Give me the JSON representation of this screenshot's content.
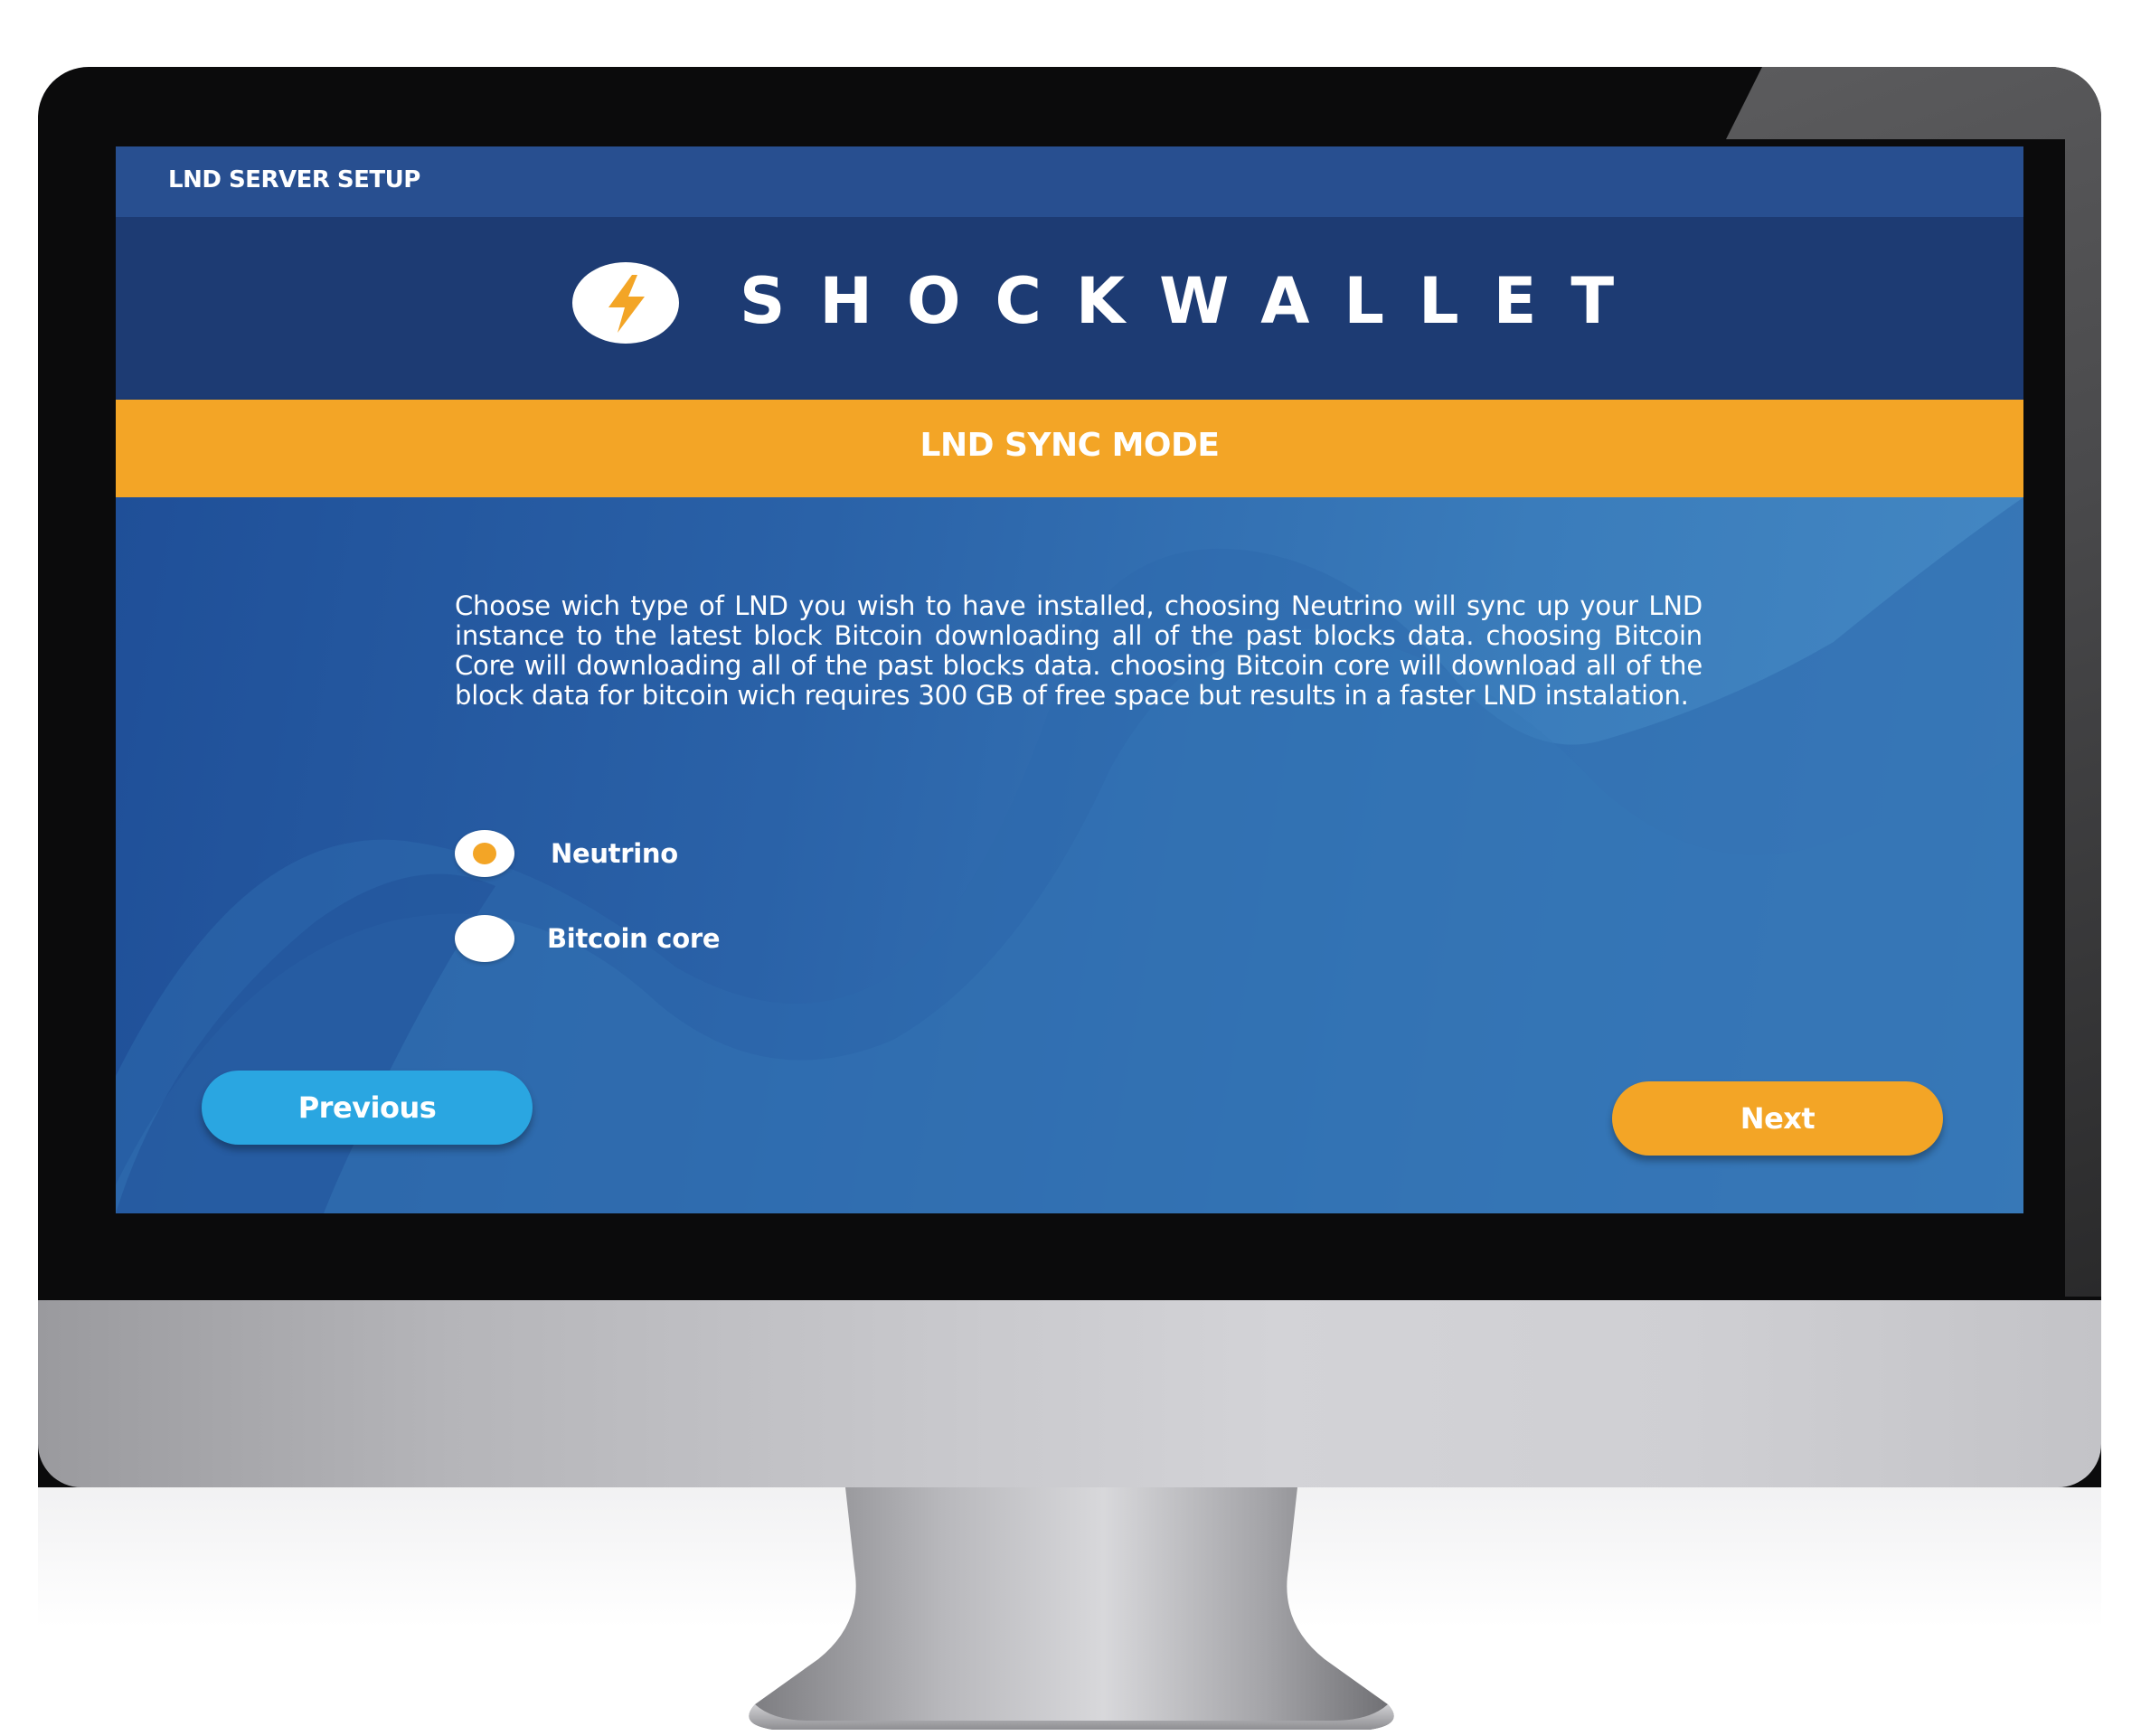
{
  "window": {
    "title": "LND SERVER SETUP"
  },
  "brand": {
    "name": "SHOCKWALLET",
    "logo_icon": "lightning-bolt-icon",
    "logo_color": "#f3a526"
  },
  "step": {
    "title": "LND SYNC MODE"
  },
  "description": "Choose wich type of LND you wish to have installed, choosing Neutrino will sync up your LND instance to the latest block Bitcoin downloading all of the past blocks data. choosing Bitcoin Core will downloading all of the past blocks data. choosing Bitcoin core will download all of the block data for bitcoin wich requires 300 GB of free space but results in a faster LND instalation.",
  "options": [
    {
      "label": "Neutrino",
      "selected": true
    },
    {
      "label": "Bitcoin core",
      "selected": false
    }
  ],
  "buttons": {
    "previous": "Previous",
    "next": "Next"
  },
  "colors": {
    "accent": "#f3a526",
    "secondary": "#2aa6e1",
    "header": "#1d3b73"
  }
}
